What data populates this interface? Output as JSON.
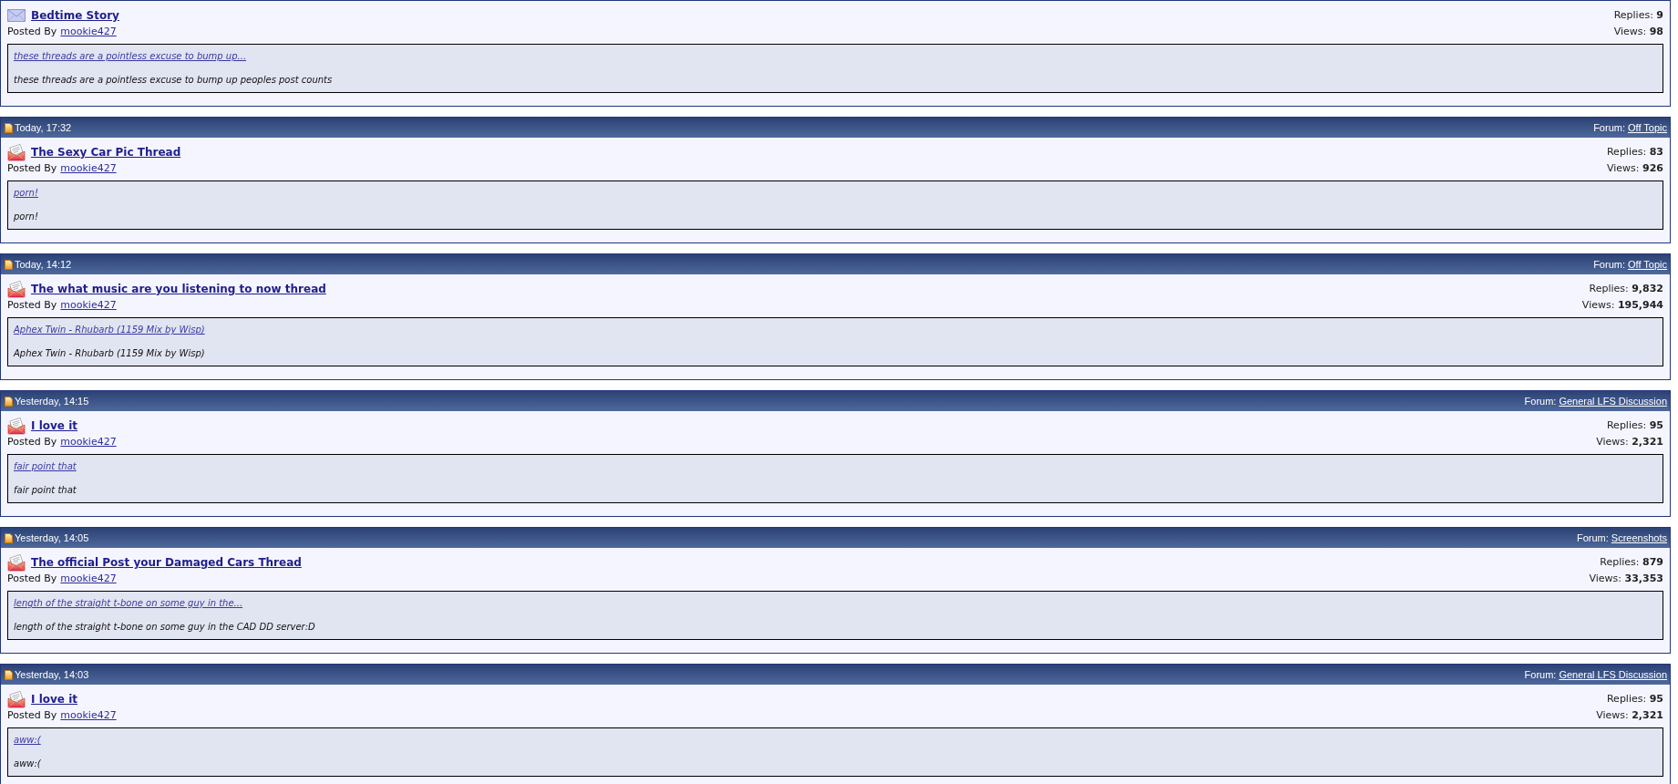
{
  "threads": [
    {
      "new": false,
      "title": "Bedtime Story",
      "posted_by_label": "Posted By",
      "author": "mookie427",
      "replies": "Replies: **9**",
      "views": "Views: **98**",
      "preview_link": "these threads are a pointless excuse to bump up...",
      "preview_text": "these threads are a pointless excuse to bump up peoples post counts"
    },
    {
      "header": {
        "date": "Today, 17:32",
        "forum_label": "Forum:",
        "forum": "Off Topic"
      },
      "new": true,
      "title": "The Sexy Car Pic Thread",
      "posted_by_label": "Posted By",
      "author": "mookie427",
      "replies": "Replies: **83**",
      "views": "Views: **926**",
      "preview_link": "porn!",
      "preview_text": "porn!"
    },
    {
      "header": {
        "date": "Today, 14:12",
        "forum_label": "Forum:",
        "forum": "Off Topic"
      },
      "new": true,
      "title": "The what music are you listening to now thread",
      "posted_by_label": "Posted By",
      "author": "mookie427",
      "replies": "Replies: **9,832**",
      "views": "Views: **195,944**",
      "preview_link": "Aphex Twin - Rhubarb (1159 Mix by Wisp)",
      "preview_text": "Aphex Twin - Rhubarb (1159 Mix by Wisp)"
    },
    {
      "header": {
        "date": "Yesterday, 14:15",
        "forum_label": "Forum:",
        "forum": "General LFS Discussion"
      },
      "new": true,
      "title": "I love it",
      "posted_by_label": "Posted By",
      "author": "mookie427",
      "replies": "Replies: **95**",
      "views": "Views: **2,321**",
      "preview_link": "fair point that",
      "preview_text": "fair point that"
    },
    {
      "header": {
        "date": "Yesterday, 14:05",
        "forum_label": "Forum:",
        "forum": "Screenshots"
      },
      "new": true,
      "title": "The official Post your Damaged Cars Thread",
      "posted_by_label": "Posted By",
      "author": "mookie427",
      "replies": "Replies: **879**",
      "views": "Views: **33,353**",
      "preview_link": "length of the straight t-bone on some guy in the...",
      "preview_text": "length of the straight t-bone on some guy in the CAD DD server:D"
    },
    {
      "header": {
        "date": "Yesterday, 14:03",
        "forum_label": "Forum:",
        "forum": "General LFS Discussion"
      },
      "new": true,
      "title": "I love it",
      "posted_by_label": "Posted By",
      "author": "mookie427",
      "replies": "Replies: **95**",
      "views": "Views: **2,321**",
      "preview_link": "aww:(",
      "preview_text": "aww:("
    }
  ]
}
